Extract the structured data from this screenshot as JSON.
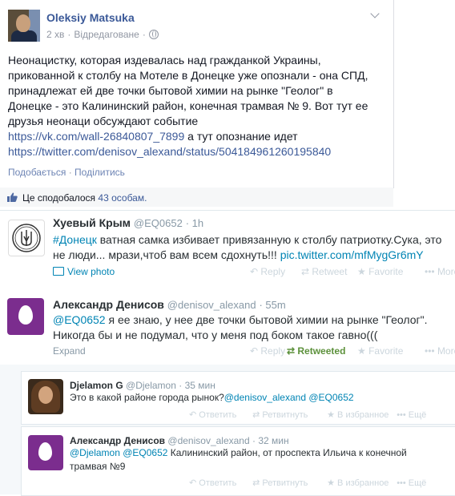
{
  "facebook_post": {
    "author": "Oleksiy Matsuka",
    "time": "2 хв",
    "edited": "Відредаговане",
    "text_lines": [
      "Неонацистку, которая издевалась над гражданкой Украины,",
      "прикованной к столбу на Мотеле в Донецке уже опознали - она СПД,",
      "принадлежат ей две точки бытовой химии на рынке \"Геолог\" в",
      "Донецке - это Калининский район, конечная трамвая № 9. Вот тут ее",
      "друзья неонаци обсуждают событие"
    ],
    "link1": "https://vk.com/wall-26840807_7899",
    "link1_suffix": " а тут опознание идет",
    "link2": "https://twitter.com/denisov_alexand/status/504184961260195840",
    "action_like": "Подобається",
    "action_share": "Поділитись",
    "likes_prefix": "Це сподобалося",
    "likes_count": "43 особам."
  },
  "tweet1": {
    "name": "Хуевый Крым",
    "handle": "@EQ0652",
    "time": "1h",
    "hashtag": "#Донецк",
    "text_line1": " ватная самка избивает привязанную к столбу патриотку.Сука, это",
    "text_line2": "не люди... мрази,чтоб вам всем сдохнуть!!! ",
    "pic_link": "pic.twitter.com/mfMygGr6mY",
    "view_photo": "View photo",
    "reply": "Reply",
    "retweet": "Retweet",
    "favorite": "Favorite",
    "more": "More"
  },
  "tweet2": {
    "name": "Александр Денисов",
    "handle": "@denisov_alexand",
    "time": "55m",
    "mention": "@EQ0652",
    "text_line1": " я ее знаю, у нее две точки бытовой химии на рынке \"Геолог\".",
    "text_line2": "Никогда бы и не подумал, что у меня под боком такое гавно(((",
    "expand": "Expand",
    "reply": "Reply",
    "retweeted": "Retweeted",
    "favorite": "Favorite",
    "more": "More"
  },
  "reply1": {
    "name": "Djelamon G",
    "handle": "@Djelamon",
    "time": "35 мин",
    "text": "Это в какой районе города рынок?",
    "mention1": "@denisov_alexand",
    "mention2": "@EQ0652",
    "reply": "Ответить",
    "retweet": "Ретвитнуть",
    "favorite": "В избранное",
    "more": "Ещё"
  },
  "reply2": {
    "name": "Александр Денисов",
    "handle": "@denisov_alexand",
    "time": "32 мин",
    "mention1": "@Djelamon",
    "mention2": "@EQ0652",
    "text_line1": " Калининский район, от проспекта Ильича к конечной",
    "text_line2": "трамвая №9",
    "reply": "Ответить",
    "retweet": "Ретвитнуть",
    "favorite": "В избранное",
    "more": "Ещё"
  },
  "colors": {
    "fb_link": "#3b5998",
    "tw_link": "#0084b4",
    "retweeted": "#5c913b",
    "egg": "#7b2d8e"
  }
}
